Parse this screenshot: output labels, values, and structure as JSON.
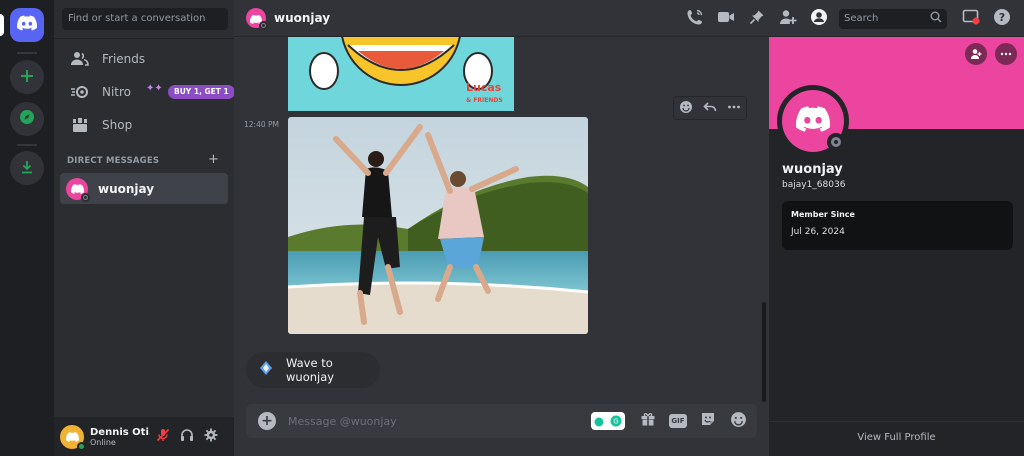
{
  "sidebar": {
    "search_placeholder": "Find or start a conversation",
    "items": [
      {
        "label": "Friends",
        "icon": "friends-icon"
      },
      {
        "label": "Nitro",
        "icon": "nitro-icon"
      },
      {
        "label": "Shop",
        "icon": "shop-icon"
      }
    ],
    "nitro_badge": "BUY 1, GET 1",
    "direct_messages_header": "DIRECT MESSAGES",
    "dm_add": "+",
    "dms": [
      {
        "name": "wuonjay"
      }
    ]
  },
  "user_panel": {
    "name": "Dennis Oti...",
    "status": "Online"
  },
  "header": {
    "title": "wuonjay",
    "search_placeholder": "Search",
    "icons": [
      "voice-call-icon",
      "video-call-icon",
      "pin-icon",
      "add-friend-icon",
      "user-profile-icon",
      "inbox-icon",
      "help-icon"
    ]
  },
  "chat": {
    "timestamp": "12:40 PM",
    "sticker_brand": "Lucas",
    "sticker_brand_sub": "& FRIENDS",
    "wave_button": "Wave to wuonjay",
    "composer_placeholder": "Message @wuonjay",
    "gif_label": "GIF"
  },
  "profile": {
    "display_name": "wuonjay",
    "username": "bajay1_68036",
    "member_since_label": "Member Since",
    "member_since_date": "Jul 26, 2024",
    "view_full_profile": "View Full Profile"
  },
  "colors": {
    "blurple": "#5865f2",
    "pink_banner": "#eb459f",
    "online_green": "#23a559",
    "nitro_purple": "#8b4cc4"
  }
}
